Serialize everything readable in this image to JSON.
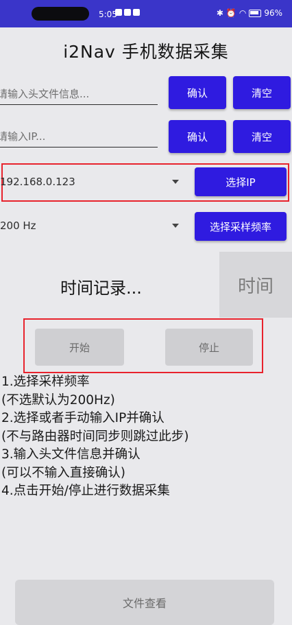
{
  "status_bar": {
    "time": "5:05",
    "battery": "96%",
    "icons": [
      "notification-icon",
      "notification-icon",
      "notification-icon",
      "bluetooth-icon",
      "alarm-icon",
      "wifi-icon",
      "battery-icon"
    ]
  },
  "app": {
    "title": "i2Nav 手机数据采集"
  },
  "header_input": {
    "placeholder": "请输入头文件信息...",
    "confirm_label": "确认",
    "clear_label": "清空"
  },
  "ip_input": {
    "placeholder": "请输入IP...",
    "confirm_label": "确认",
    "clear_label": "清空"
  },
  "ip_select": {
    "selected": "192.168.0.123",
    "button_label": "选择IP"
  },
  "rate_select": {
    "selected": "200 Hz",
    "button_label": "选择采样频率"
  },
  "time_record": {
    "label": "时间记录...",
    "time_box": "时间"
  },
  "controls": {
    "start_label": "开始",
    "stop_label": "停止"
  },
  "instructions": [
    "1.选择采样频率",
    "(不选默认为200Hz)",
    "2.选择或者手动输入IP并确认",
    "(不与路由器时间同步则跳过此步)",
    "3.输入头文件信息并确认",
    "(可以不输入直接确认)",
    "4.点击开始/停止进行数据采集"
  ],
  "bottom": {
    "file_view_label": "文件查看"
  },
  "colors": {
    "primary": "#2f1be0",
    "highlight": "#e8222c",
    "statusbar": "#3a35c9"
  }
}
